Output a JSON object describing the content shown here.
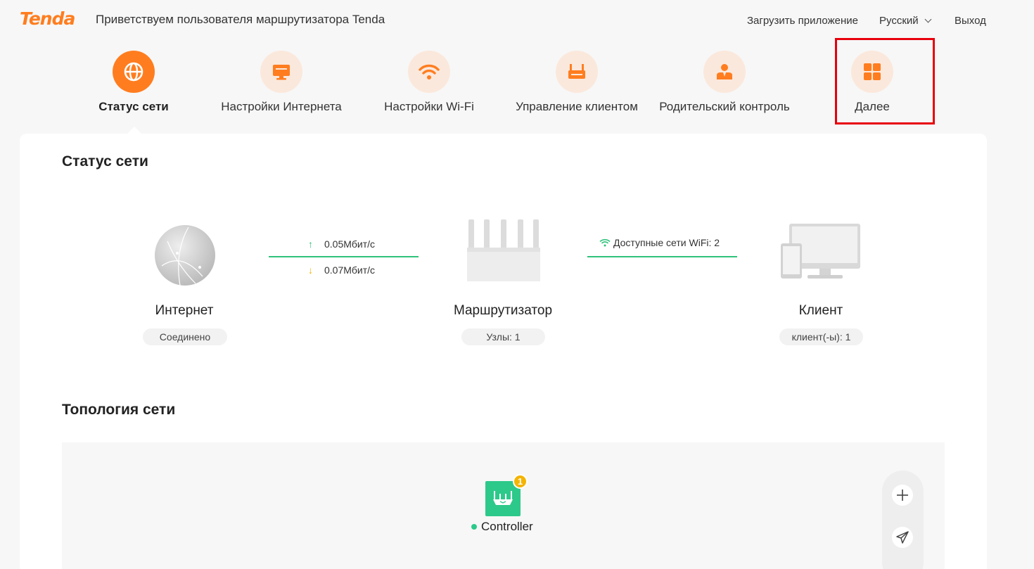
{
  "header": {
    "logo_text": "Tenda",
    "welcome": "Приветствуем пользователя маршрутизатора Tenda",
    "download_app": "Загрузить приложение",
    "language": "Русский",
    "logout": "Выход"
  },
  "nav": {
    "items": [
      {
        "label": "Статус сети",
        "icon": "globe-icon",
        "active": true
      },
      {
        "label": "Настройки Интернета",
        "icon": "monitor-icon",
        "active": false
      },
      {
        "label": "Настройки Wi-Fi",
        "icon": "wifi-icon",
        "active": false
      },
      {
        "label": "Управление клиентом",
        "icon": "router-icon",
        "active": false
      },
      {
        "label": "Родительский контроль",
        "icon": "person-icon",
        "active": false
      },
      {
        "label": "Далее",
        "icon": "grid-icon",
        "active": false
      }
    ]
  },
  "status": {
    "title": "Статус сети",
    "internet": {
      "label": "Интернет",
      "status": "Соединено"
    },
    "upload": "0.05Мбит/с",
    "download": "0.07Мбит/с",
    "router": {
      "label": "Маршрутизатор",
      "nodes": "Узлы: 1"
    },
    "wifi_available": "Доступные сети WiFi: 2",
    "client": {
      "label": "Клиент",
      "count": "клиент(-ы): 1"
    }
  },
  "topology": {
    "title": "Топология сети",
    "controller_label": "Controller",
    "controller_badge": "1"
  },
  "colors": {
    "accent": "#ff7d1f",
    "accent_light": "#fbe8dc",
    "green": "#2fc27a",
    "highlight": "#e8000c"
  }
}
